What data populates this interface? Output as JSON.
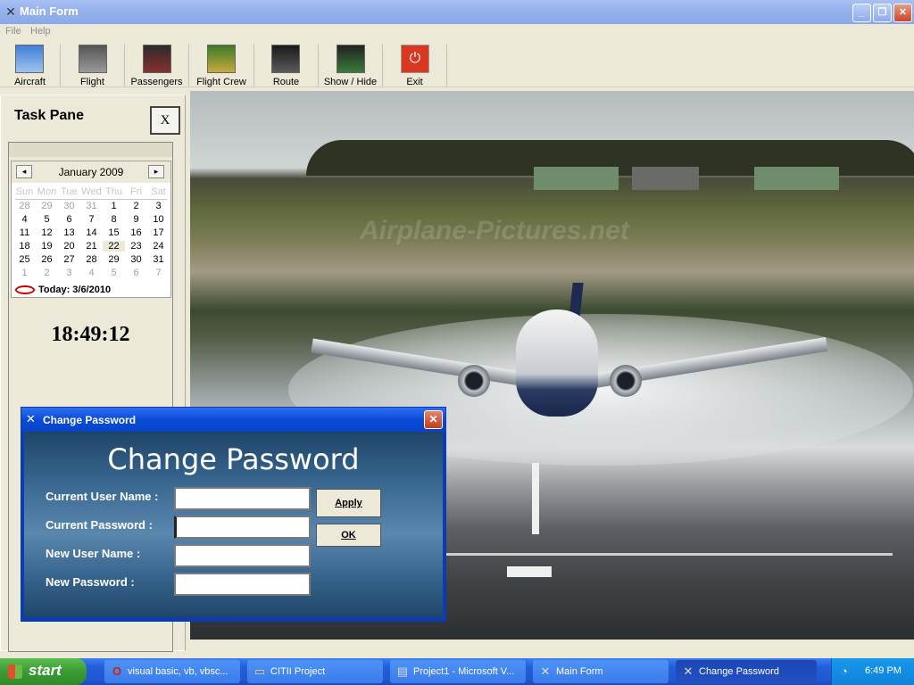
{
  "window": {
    "title": "Main Form"
  },
  "menu": [
    "File",
    "Help"
  ],
  "toolbar": [
    {
      "label": "Aircraft",
      "icon": "aircraft-icon"
    },
    {
      "label": "Flight",
      "icon": "flight-icon"
    },
    {
      "label": "Passengers",
      "icon": "passengers-icon"
    },
    {
      "label": "Flight Crew",
      "icon": "flight-crew-icon"
    },
    {
      "label": "Route",
      "icon": "route-icon"
    },
    {
      "label": "Show / Hide",
      "icon": "show-hide-icon"
    },
    {
      "label": "Exit",
      "icon": "exit-icon"
    }
  ],
  "taskpane": {
    "title": "Task Pane",
    "close_label": "X",
    "calendar": {
      "month": "January 2009",
      "prev": "◂",
      "next": "▸",
      "weekdays": [
        "Sun",
        "Mon",
        "Tue",
        "Wed",
        "Thu",
        "Fri",
        "Sat"
      ],
      "weeks": [
        [
          "28",
          "29",
          "30",
          "31",
          "1",
          "2",
          "3"
        ],
        [
          "4",
          "5",
          "6",
          "7",
          "8",
          "9",
          "10"
        ],
        [
          "11",
          "12",
          "13",
          "14",
          "15",
          "16",
          "17"
        ],
        [
          "18",
          "19",
          "20",
          "21",
          "22",
          "23",
          "24"
        ],
        [
          "25",
          "26",
          "27",
          "28",
          "29",
          "30",
          "31"
        ],
        [
          "1",
          "2",
          "3",
          "4",
          "5",
          "6",
          "7"
        ]
      ],
      "today": "Today: 3/6/2010"
    },
    "clock": "18:49:12"
  },
  "background": {
    "watermark": "Airplane-Pictures.net"
  },
  "dialog": {
    "title": "Change Password",
    "heading": "Change Password",
    "fields": [
      {
        "label": "Current User Name :",
        "value": ""
      },
      {
        "label": "Current Password :",
        "value": ""
      },
      {
        "label": "New User Name :",
        "value": ""
      },
      {
        "label": "New Password :",
        "value": ""
      }
    ],
    "apply_label": "Apply",
    "ok_label": "OK"
  },
  "taskbar": {
    "start_label": "start",
    "buttons": [
      {
        "label": "visual basic, vb, vbsc...",
        "icon": "opera-icon"
      },
      {
        "label": "CITII Project",
        "icon": "folder-icon"
      },
      {
        "label": "Project1 - Microsoft V...",
        "icon": "vb-ide-icon"
      },
      {
        "label": "Main Form",
        "icon": "form-icon"
      },
      {
        "label": "Change Password",
        "icon": "form-icon"
      }
    ],
    "clock": "6:49 PM"
  },
  "colors": {
    "titlebar": "#97b3ee",
    "dialog_title": "#0a4bd6",
    "taskbar": "#245edb",
    "start": "#3c9b34"
  }
}
